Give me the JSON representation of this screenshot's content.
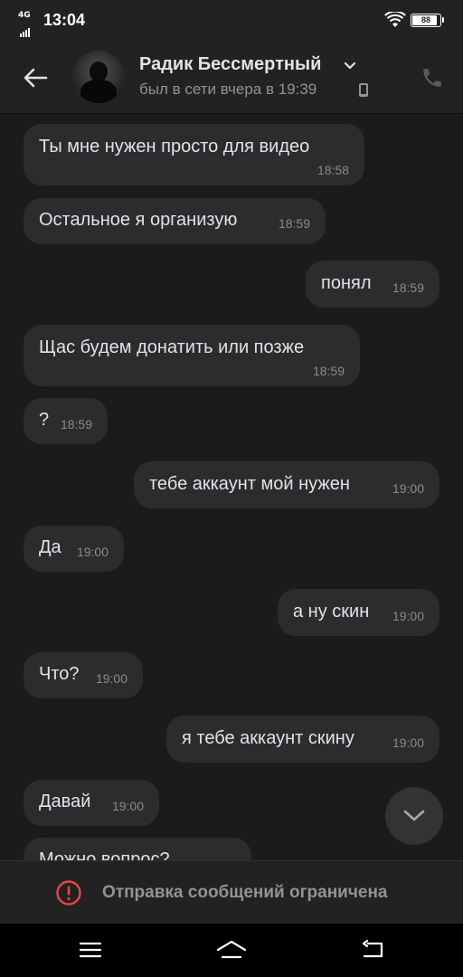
{
  "status_bar": {
    "network": "4G",
    "time": "13:04",
    "battery": "88"
  },
  "header": {
    "contact_name": "Радик Бессмертный",
    "last_seen": "был в сети вчера в 19:39",
    "icons": {
      "back": "arrow-left-icon",
      "expand": "chevron-down-icon",
      "device": "phone-device-icon",
      "call": "phone-call-icon"
    }
  },
  "messages": [
    {
      "side": "in",
      "text": "Ты мне нужен просто для видео",
      "time": "18:58"
    },
    {
      "side": "in",
      "text": "Остальное я организую",
      "time": "18:59"
    },
    {
      "side": "out",
      "text": "понял",
      "time": "18:59"
    },
    {
      "side": "in",
      "text": "Щас будем донатить или позже",
      "time": "18:59"
    },
    {
      "side": "in",
      "text": "?",
      "time": "18:59"
    },
    {
      "side": "out",
      "text": "тебе аккаунт мой нужен",
      "time": "19:00"
    },
    {
      "side": "in",
      "text": "Да",
      "time": "19:00"
    },
    {
      "side": "out",
      "text": "а ну скин",
      "time": "19:00"
    },
    {
      "side": "in",
      "text": "Что?",
      "time": "19:00"
    },
    {
      "side": "out",
      "text": "я тебе аккаунт скину",
      "time": "19:00"
    },
    {
      "side": "in",
      "text": "Давай",
      "time": "19:00"
    },
    {
      "side": "in",
      "text": "Можно вопрос?",
      "time": ""
    }
  ],
  "restricted": {
    "text": "Отправка сообщений ограничена",
    "icon": "warning-circle-icon",
    "icon_color": "#e64646"
  },
  "colors": {
    "background": "#1b1b1c",
    "bubble": "#2c2c2e",
    "header": "#222223",
    "muted_text": "#939393"
  }
}
